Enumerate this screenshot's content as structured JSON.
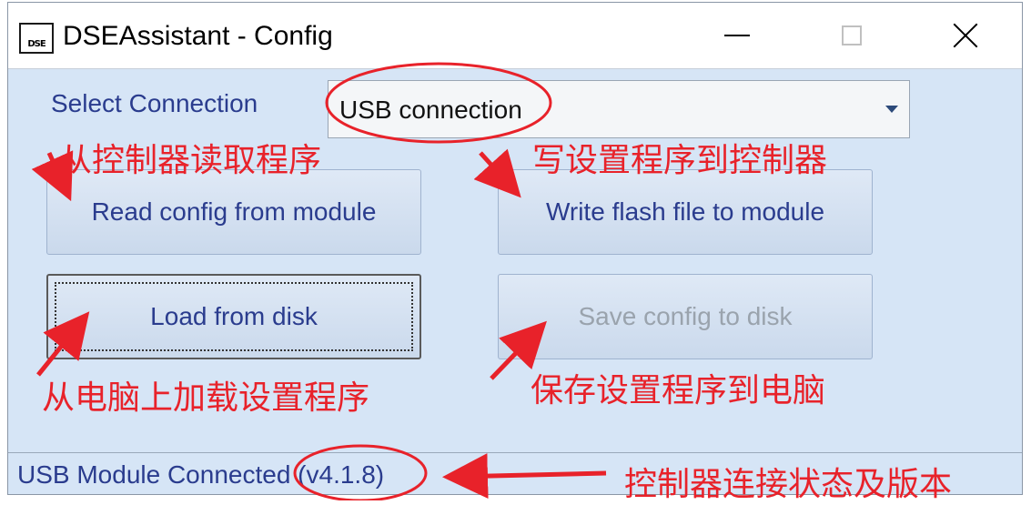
{
  "window": {
    "title": "DSEAssistant - Config",
    "icon_label": "DSE",
    "controls": {
      "minimize": "minimize-icon",
      "maximize": "maximize-icon",
      "close": "close-icon"
    }
  },
  "connection": {
    "label": "Select Connection",
    "selected": "USB connection"
  },
  "buttons": {
    "read": "Read config from module",
    "write": "Write flash file to module",
    "load": "Load from disk",
    "save": "Save config to disk"
  },
  "status": {
    "text": "USB Module Connected (v4.1.8)"
  },
  "annotations": {
    "read": "从控制器读取程序",
    "write": "写设置程序到控制器",
    "load": "从电脑上加载设置程序",
    "save": "保存设置程序到电脑",
    "status": "控制器连接状态及版本"
  },
  "colors": {
    "accent_text": "#2a3c8e",
    "annotation": "#e8222a",
    "window_bg": "#d6e5f6"
  }
}
